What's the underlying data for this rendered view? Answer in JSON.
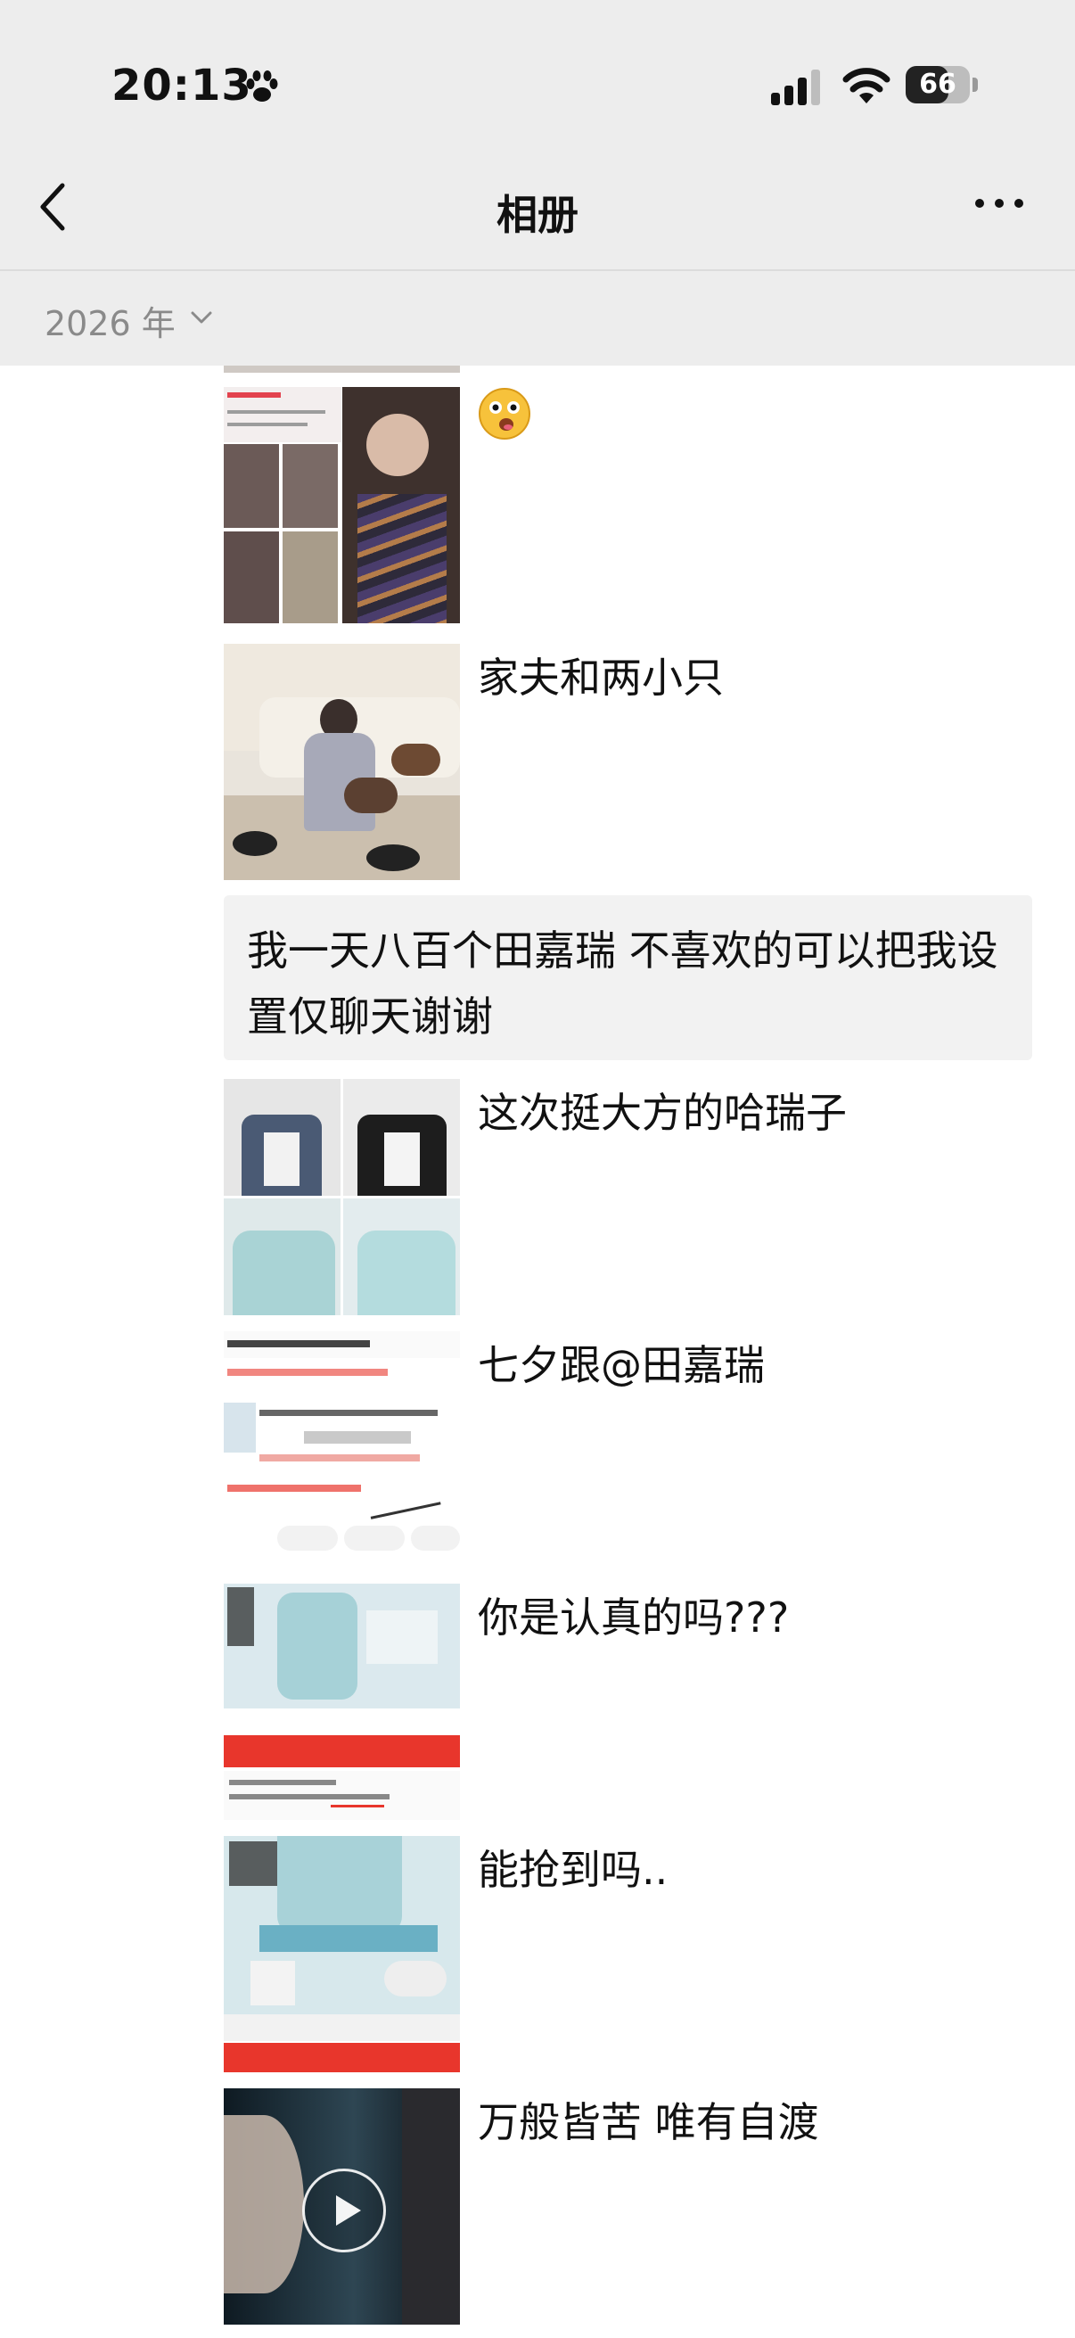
{
  "status": {
    "time": "20:13",
    "battery": "66",
    "battery_level": 0.66
  },
  "nav": {
    "title": "相册",
    "back_icon": "chevron-left-icon",
    "more_icon": "more-dots-icon"
  },
  "year_header": {
    "label": "2026 年"
  },
  "entries": [
    {
      "type": "photo",
      "caption": ""
    },
    {
      "type": "photo",
      "caption": "家夫和两小只"
    },
    {
      "type": "text",
      "caption": "我一天八百个田嘉瑞 不喜欢的可以把我设置仅聊天谢谢"
    },
    {
      "type": "photo",
      "caption": "这次挺大方的哈瑞子"
    },
    {
      "type": "photo",
      "caption": "七夕跟@田嘉瑞"
    },
    {
      "type": "photo",
      "caption": "你是认真的吗???"
    },
    {
      "type": "photo",
      "caption": "能抢到吗.."
    },
    {
      "type": "video",
      "caption": "万般皆苦 唯有自渡"
    }
  ],
  "colors": {
    "header_bg": "#ededed",
    "feed_bg": "#ffffff",
    "text_bubble_bg": "#f2f2f2",
    "accent_red": "#e8362c"
  }
}
